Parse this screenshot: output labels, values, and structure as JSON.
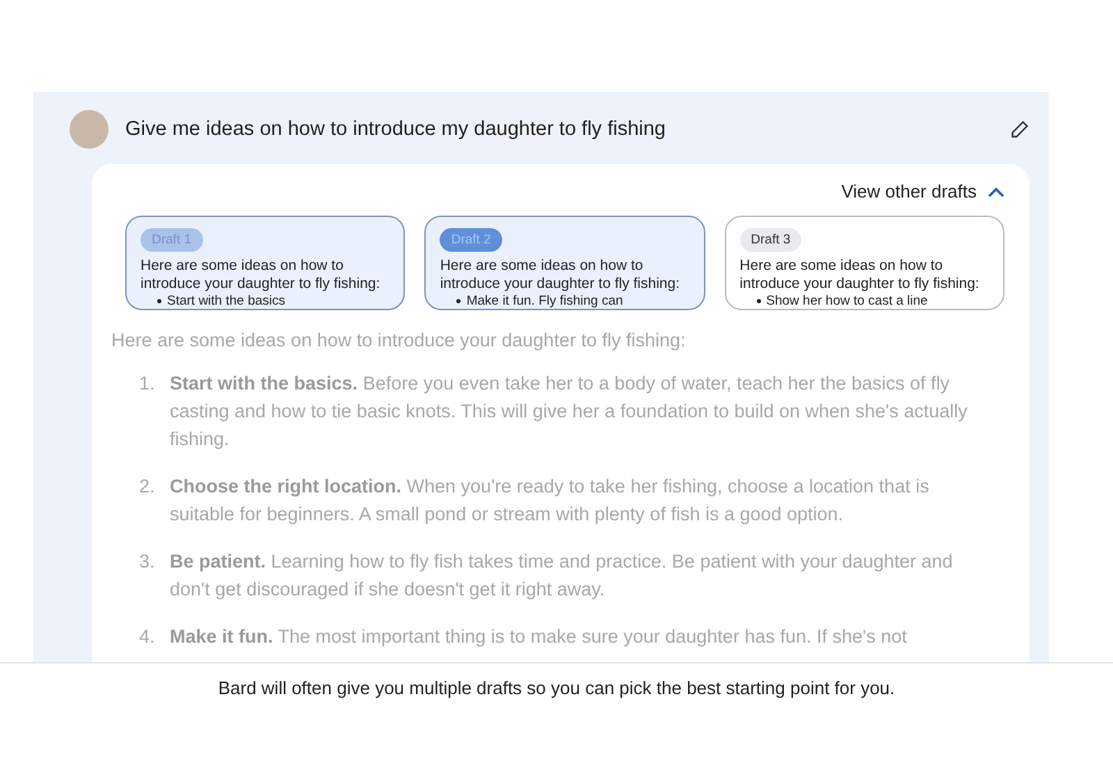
{
  "prompt": {
    "text": "Give me ideas on how to introduce my daughter to fly fishing"
  },
  "drafts_toggle": {
    "label": "View other drafts",
    "expanded": true
  },
  "drafts": [
    {
      "label": "Draft 1",
      "text": "Here are some ideas on how to introduce your daughter to fly fishing:",
      "bullet": "Start with the basics",
      "tinted": true,
      "selected": false
    },
    {
      "label": "Draft 2",
      "text": "Here are some ideas on how to introduce your daughter to fly fishing:",
      "bullet": "Make it fun. Fly fishing can",
      "tinted": true,
      "selected": true
    },
    {
      "label": "Draft 3",
      "text": "Here are some ideas on how to introduce your daughter to fly fishing:",
      "bullet": "Show her how to cast a line",
      "tinted": false,
      "selected": false
    }
  ],
  "response": {
    "intro": "Here are some ideas on how to introduce your daughter to fly fishing:",
    "items": [
      {
        "number": "1.",
        "title": "Start with the basics.",
        "text": "Before you even take her to a body of water, teach her the basics of fly casting and how to tie basic knots. This will give her a foundation to build on when she's actually fishing."
      },
      {
        "number": "2.",
        "title": "Choose the right location.",
        "text": "When you're ready to take her fishing, choose a location that is suitable for beginners. A small pond or stream with plenty of fish is a good option."
      },
      {
        "number": "3.",
        "title": "Be patient.",
        "text": "Learning how to fly fish takes time and practice. Be patient with your daughter and don't get discouraged if she doesn't get it right away."
      },
      {
        "number": "4.",
        "title": "Make it fun.",
        "text": "The most important thing is to make sure your daughter has fun. If she's not"
      }
    ]
  },
  "caption": "Bard will often give you multiple drafts so you can pick the best starting point for you."
}
